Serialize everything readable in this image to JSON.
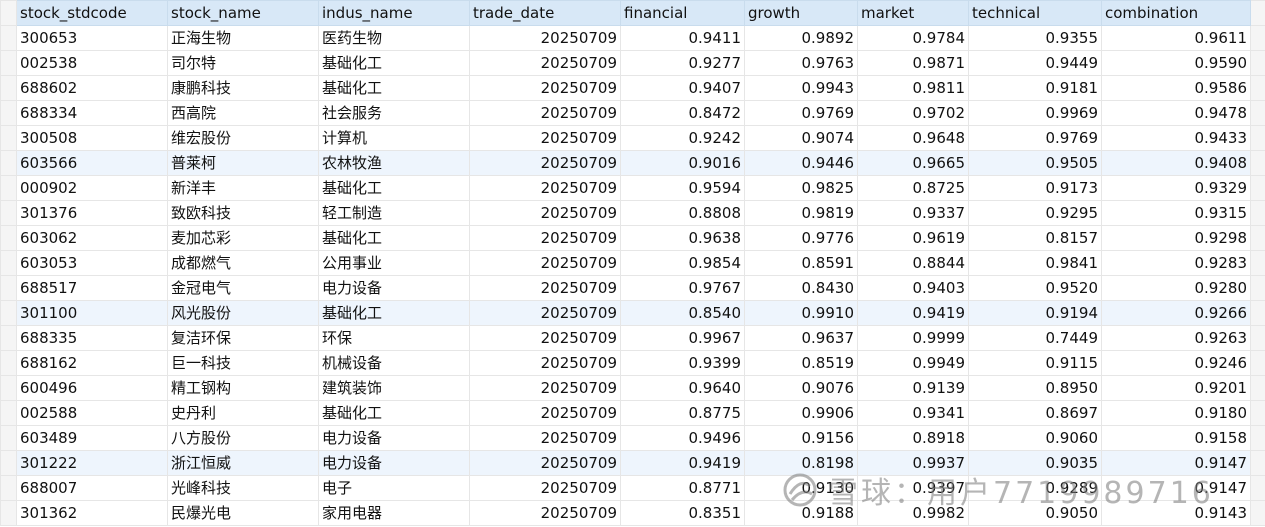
{
  "columns": [
    "stock_stdcode",
    "stock_name",
    "indus_name",
    "trade_date",
    "financial",
    "growth",
    "market",
    "technical",
    "combination"
  ],
  "rows": [
    [
      "300653",
      "正海生物",
      "医药生物",
      "20250709",
      "0.9411",
      "0.9892",
      "0.9784",
      "0.9355",
      "0.9611"
    ],
    [
      "002538",
      "司尔特",
      "基础化工",
      "20250709",
      "0.9277",
      "0.9763",
      "0.9871",
      "0.9449",
      "0.9590"
    ],
    [
      "688602",
      "康鹏科技",
      "基础化工",
      "20250709",
      "0.9407",
      "0.9943",
      "0.9811",
      "0.9181",
      "0.9586"
    ],
    [
      "688334",
      "西高院",
      "社会服务",
      "20250709",
      "0.8472",
      "0.9769",
      "0.9702",
      "0.9969",
      "0.9478"
    ],
    [
      "300508",
      "维宏股份",
      "计算机",
      "20250709",
      "0.9242",
      "0.9074",
      "0.9648",
      "0.9769",
      "0.9433"
    ],
    [
      "603566",
      "普莱柯",
      "农林牧渔",
      "20250709",
      "0.9016",
      "0.9446",
      "0.9665",
      "0.9505",
      "0.9408"
    ],
    [
      "000902",
      "新洋丰",
      "基础化工",
      "20250709",
      "0.9594",
      "0.9825",
      "0.8725",
      "0.9173",
      "0.9329"
    ],
    [
      "301376",
      "致欧科技",
      "轻工制造",
      "20250709",
      "0.8808",
      "0.9819",
      "0.9337",
      "0.9295",
      "0.9315"
    ],
    [
      "603062",
      "麦加芯彩",
      "基础化工",
      "20250709",
      "0.9638",
      "0.9776",
      "0.9619",
      "0.8157",
      "0.9298"
    ],
    [
      "603053",
      "成都燃气",
      "公用事业",
      "20250709",
      "0.9854",
      "0.8591",
      "0.8844",
      "0.9841",
      "0.9283"
    ],
    [
      "688517",
      "金冠电气",
      "电力设备",
      "20250709",
      "0.9767",
      "0.8430",
      "0.9403",
      "0.9520",
      "0.9280"
    ],
    [
      "301100",
      "风光股份",
      "基础化工",
      "20250709",
      "0.8540",
      "0.9910",
      "0.9419",
      "0.9194",
      "0.9266"
    ],
    [
      "688335",
      "复洁环保",
      "环保",
      "20250709",
      "0.9967",
      "0.9637",
      "0.9999",
      "0.7449",
      "0.9263"
    ],
    [
      "688162",
      "巨一科技",
      "机械设备",
      "20250709",
      "0.9399",
      "0.8519",
      "0.9949",
      "0.9115",
      "0.9246"
    ],
    [
      "600496",
      "精工钢构",
      "建筑装饰",
      "20250709",
      "0.9640",
      "0.9076",
      "0.9139",
      "0.8950",
      "0.9201"
    ],
    [
      "002588",
      "史丹利",
      "基础化工",
      "20250709",
      "0.8775",
      "0.9906",
      "0.9341",
      "0.8697",
      "0.9180"
    ],
    [
      "603489",
      "八方股份",
      "电力设备",
      "20250709",
      "0.9496",
      "0.9156",
      "0.8918",
      "0.9060",
      "0.9158"
    ],
    [
      "301222",
      "浙江恒威",
      "电力设备",
      "20250709",
      "0.9419",
      "0.8198",
      "0.9937",
      "0.9035",
      "0.9147"
    ],
    [
      "688007",
      "光峰科技",
      "电子",
      "20250709",
      "0.8771",
      "0.9130",
      "0.9397",
      "0.9289",
      "0.9147"
    ],
    [
      "301362",
      "民爆光电",
      "家用电器",
      "20250709",
      "0.8351",
      "0.9188",
      "0.9982",
      "0.9050",
      "0.9143"
    ]
  ],
  "highlighted_rows": [
    5,
    11,
    17
  ],
  "watermark": {
    "brand": "雪球",
    "user": "用户7719989716",
    "separator": "："
  }
}
